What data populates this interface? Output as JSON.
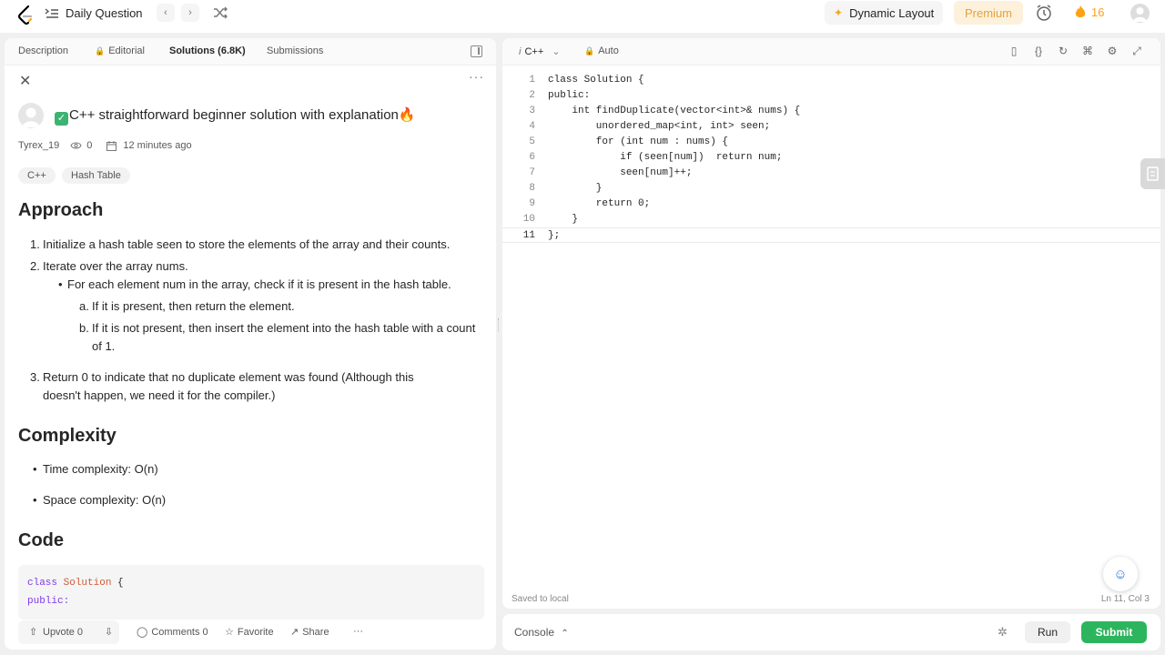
{
  "topbar": {
    "title": "Daily Question",
    "prev": "‹",
    "next": "›",
    "dynamic_layout": "Dynamic Layout",
    "premium": "Premium",
    "streak_count": "16"
  },
  "tabs": [
    {
      "label": "Description"
    },
    {
      "label": "Editorial"
    },
    {
      "label": "Solutions (6.8K)"
    },
    {
      "label": "Submissions"
    }
  ],
  "solution": {
    "title": "C++ straightforward beginner solution with explanation🔥",
    "author": "Tyrex_19",
    "views": "0",
    "time": "12 minutes ago",
    "tags": [
      "C++",
      "Hash Table"
    ],
    "approach_heading": "Approach",
    "approach_items": [
      "Initialize a hash table seen to store the elements of the array and their counts.",
      "Iterate over the array nums.",
      "For each element num in the array, check if it is present in the hash table.",
      "If it is present, then return the element.",
      "If it is not present, then insert the element into the hash table with a count of 1.",
      "Return 0 to indicate that no duplicate element was found (Although this doesn't happen, we need it for the compiler.)"
    ],
    "markers": [
      "1.",
      "2.",
      "•",
      "a.",
      "b.",
      "3."
    ],
    "complexity_heading": "Complexity",
    "complexity_items": [
      "Time complexity: O(n)",
      "Space complexity: O(n)"
    ],
    "code_heading": "Code",
    "code_line1_kw": "class",
    "code_line1_name": "Solution",
    "code_line1_brace": " {",
    "code_line2": "public:",
    "upvote": "Upvote 0",
    "comments": "Comments 0",
    "favorite": "Favorite",
    "share": "Share"
  },
  "editor": {
    "language": "C++",
    "mode": "Auto",
    "lines": [
      {
        "n": "1"
      },
      {
        "n": "2"
      },
      {
        "n": "3"
      },
      {
        "n": "4"
      },
      {
        "n": "5"
      },
      {
        "n": "6"
      },
      {
        "n": "7"
      },
      {
        "n": "8"
      },
      {
        "n": "9"
      },
      {
        "n": "10"
      },
      {
        "n": "11"
      }
    ],
    "code_lines": [
      "class Solution {",
      "public:",
      "    int findDuplicate(vector<int>& nums) {",
      "        unordered_map<int, int> seen;",
      "        for (int num : nums) {",
      "            if (seen[num])  return num;",
      "            seen[num]++;",
      "        }",
      "        return 0;",
      "    }",
      "};"
    ],
    "saved": "Saved to local",
    "position": "Ln 11, Col 3"
  },
  "console": {
    "label": "Console",
    "run": "Run",
    "submit": "Submit"
  },
  "colors": {
    "accent_orange": "#ffa116",
    "submit_green": "#2db55d",
    "premium_text": "#e6a23c"
  }
}
